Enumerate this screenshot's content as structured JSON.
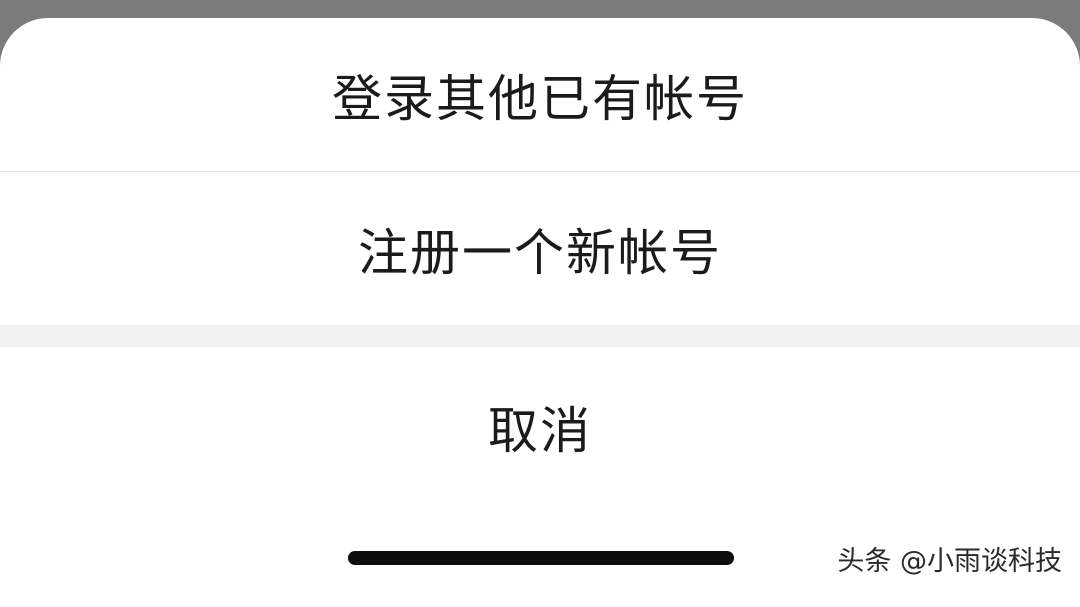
{
  "action_sheet": {
    "options": [
      {
        "label": "登录其他已有帐号"
      },
      {
        "label": "注册一个新帐号"
      }
    ],
    "cancel_label": "取消"
  },
  "watermark": {
    "text": "头条 @小雨谈科技"
  },
  "colors": {
    "backdrop": "#7b7b7b",
    "sheet": "#ffffff",
    "text": "#1b1b1b",
    "divider": "#e3e3e3",
    "group_gap": "#f2f2f2",
    "home_indicator": "#0d0d0d"
  }
}
